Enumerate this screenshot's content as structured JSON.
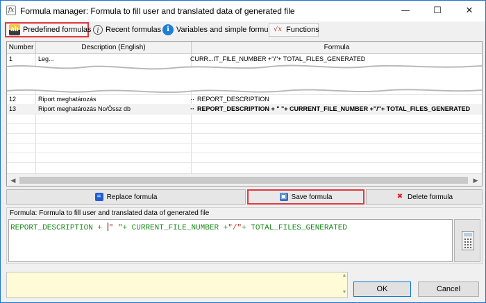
{
  "window": {
    "title": "Formula manager: Formula to fill user and translated data of generated file",
    "controls": {
      "minimize": "—",
      "maximize": "☐",
      "close": "✕"
    }
  },
  "tabs": [
    {
      "label": "Predefined formulas",
      "icon": "calculator-icon",
      "highlighted": true
    },
    {
      "label": "Recent formulas",
      "icon": "clock-icon"
    },
    {
      "label": "Variables and simple formulas",
      "icon": "info-icon"
    },
    {
      "label": "Functions",
      "icon": "function-icon"
    }
  ],
  "grid": {
    "columns": [
      "Number",
      "Description (English)",
      "Formula"
    ],
    "rows": [
      {
        "number": "1",
        "description": "Leg...",
        "formula": "CURR...IT_FILE_NUMBER +\"/\"+ TOTAL_FILES_GENERATED"
      },
      {
        "number": "12",
        "description": "Riport meghatározás",
        "formula": "REPORT_DESCRIPTION"
      },
      {
        "number": "13",
        "description": "Riport meghatározás No/Össz db",
        "formula": "REPORT_DESCRIPTION + \" \"+ CURRENT_FILE_NUMBER +\"/\"+ TOTAL_FILES_GENERATED",
        "selected": true
      }
    ]
  },
  "actions": {
    "replace": "Replace formula",
    "save": "Save formula",
    "delete": "Delete formula"
  },
  "formula_editor": {
    "label": "Formula: Formula to fill user and translated data of generated file",
    "part1": "REPORT_DESCRIPTION + ",
    "part2": "\" \"",
    "part3": "+ CURRENT_FILE_NUMBER +",
    "part4": "\"/\"",
    "part5": "+ TOTAL_FILES_GENERATED"
  },
  "dialog": {
    "ok": "OK",
    "cancel": "Cancel"
  },
  "colors": {
    "highlight": "#e0393e",
    "accent": "#1c75d1",
    "message_bg": "#fffbd7",
    "formula_text": "#1b8a1b"
  }
}
